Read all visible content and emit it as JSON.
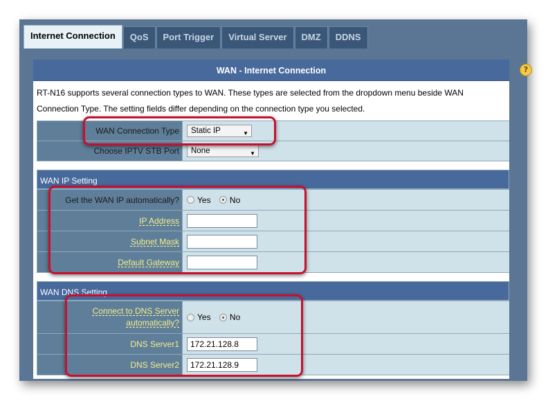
{
  "tabs": [
    {
      "label": "Internet Connection",
      "active": true
    },
    {
      "label": "QoS"
    },
    {
      "label": "Port Trigger"
    },
    {
      "label": "Virtual Server"
    },
    {
      "label": "DMZ"
    },
    {
      "label": "DDNS"
    }
  ],
  "panel": {
    "title": "WAN - Internet Connection",
    "description": "RT-N16 supports several connection types to WAN. These types are selected from the dropdown menu beside WAN Connection Type. The setting fields differ depending on the connection type you selected."
  },
  "basic": {
    "wan_type_label": "WAN Connection Type",
    "wan_type_value": "Static IP",
    "iptv_label": "Choose IPTV STB Port",
    "iptv_value": "None"
  },
  "wan_ip": {
    "header": "WAN IP Setting",
    "auto_label": "Get the WAN IP automatically?",
    "yes_label": "Yes",
    "no_label": "No",
    "auto_selected": "No",
    "ip_label": "IP Address",
    "ip_value": "",
    "mask_label": "Subnet Mask",
    "mask_value": "",
    "gw_label": "Default Gateway",
    "gw_value": ""
  },
  "wan_dns": {
    "header": "WAN DNS Setting",
    "auto_label_1": "Connect to DNS Server",
    "auto_label_2": "automatically?",
    "yes_label": "Yes",
    "no_label": "No",
    "auto_selected": "No",
    "dns1_label": "DNS Server1",
    "dns1_value": "172.21.128.8",
    "dns2_label": "DNS Server2",
    "dns2_value": "172.21.128.9"
  },
  "colors": {
    "highlight": "#c8102e",
    "header": "#48699b",
    "label_cell": "#5f7e99",
    "value_cell": "#cfe2e9",
    "link_yellow": "#f4ef8c"
  }
}
